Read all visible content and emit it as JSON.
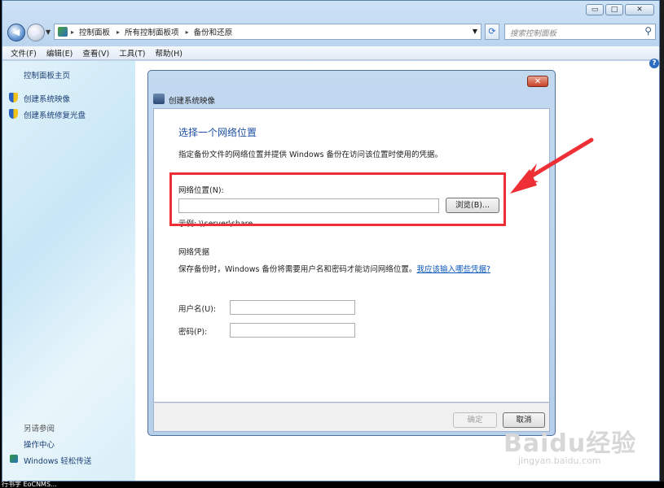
{
  "explorer": {
    "caption_buttons": [
      "▭",
      "□",
      "✕"
    ],
    "address_crumbs": [
      "控制面板",
      "所有控制面板项",
      "备份和还原"
    ],
    "search_placeholder": "搜索控制面板",
    "menu": [
      "文件(F)",
      "编辑(E)",
      "查看(V)",
      "工具(T)",
      "帮助(H)"
    ],
    "help_glyph": "?"
  },
  "sidebar": {
    "home": "控制面板主页",
    "items": [
      "创建系统映像",
      "创建系统修复光盘"
    ],
    "see_also_label": "另请参阅",
    "see_also": [
      "操作中心",
      "Windows 轻松传送"
    ]
  },
  "dialog": {
    "title": "创建系统映像",
    "heading": "选择一个网络位置",
    "description": "指定备份文件的网络位置并提供 Windows 备份在访问该位置时使用的凭据。",
    "network_location_label": "网络位置(N):",
    "network_location_value": "",
    "browse_button": "浏览(B)...",
    "example": "示例: \\\\server\\share",
    "credentials_label": "网络凭据",
    "credentials_text": "保存备份时，Windows 备份将需要用户名和密码才能访问网络位置。",
    "credentials_link": "我应该输入哪些凭据?",
    "username_label": "用户名(U):",
    "username_value": "",
    "password_label": "密码(P):",
    "password_value": "",
    "ok_button": "确定",
    "cancel_button": "取消"
  },
  "annotation": {
    "highlight_color": "#ee2f35"
  },
  "watermark": {
    "text": "Baidu经验",
    "url": "jingyan.baidu.com"
  },
  "taskbar": {
    "bottom_text": "行书字 EoCNMS..."
  }
}
